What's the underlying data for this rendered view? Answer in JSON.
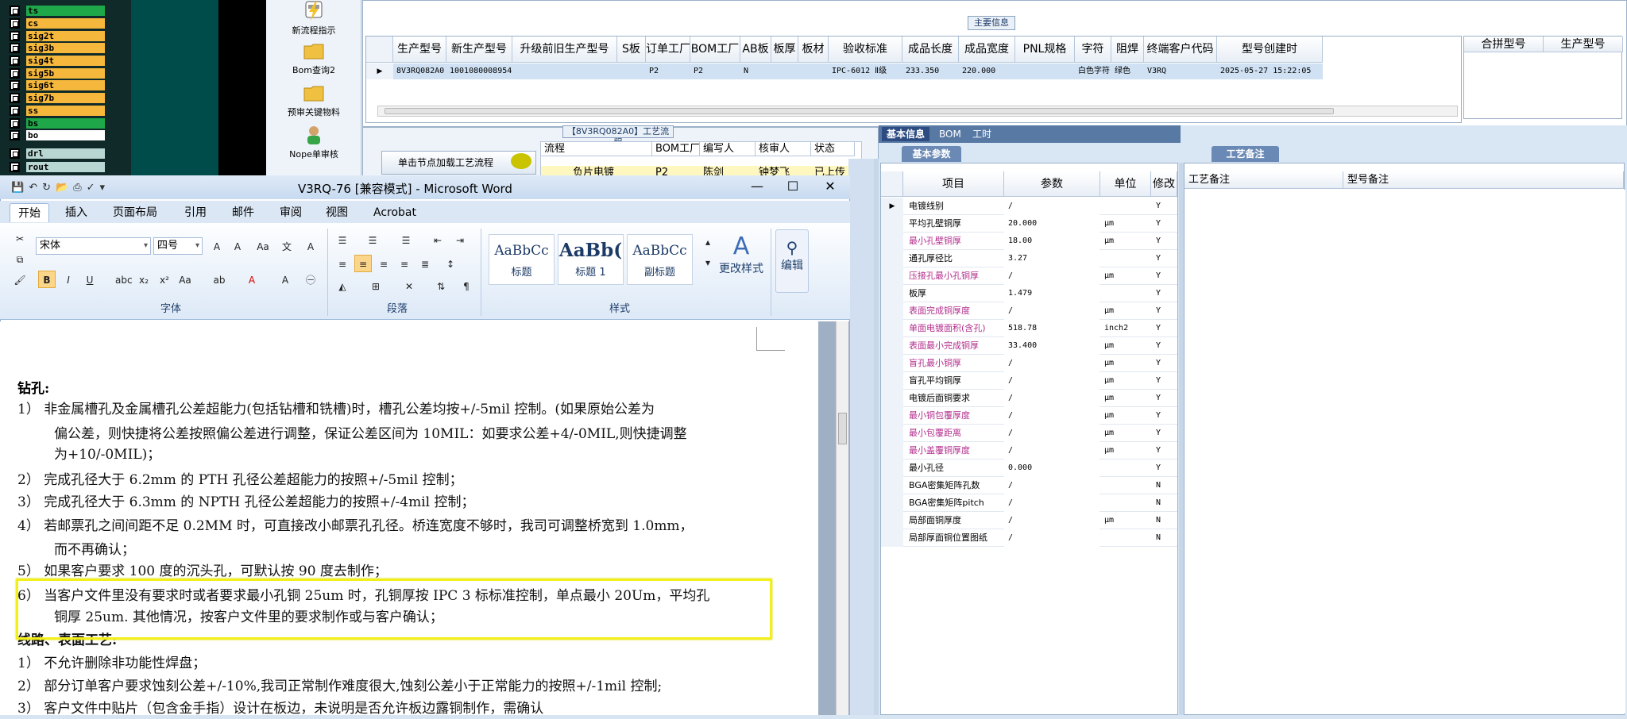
{
  "signals": [
    "ts",
    "cs",
    "sig2t",
    "sig3b",
    "sig4t",
    "sig5b",
    "sig6t",
    "sig7b",
    "ss",
    "bs",
    "bo",
    "drl",
    "rout"
  ],
  "signal_colors": [
    "#1fa84a",
    "#f6b83c",
    "#f6b83c",
    "#f6b83c",
    "#f6b83c",
    "#f6b83c",
    "#f6b83c",
    "#f6b83c",
    "#f6b83c",
    "#1fa84a",
    "#ffffff",
    "#b9d7d2",
    "#b9d7d2"
  ],
  "tools": {
    "new_flow": "新流程指示",
    "bom_query": "Bom查询2",
    "review_material": "预审关键物料",
    "nope_review": "Nope单审核"
  },
  "main": {
    "section_title": "主要信息",
    "columns": [
      "生产型号",
      "新生产型号",
      "升级前旧生产型号",
      "S板",
      "订单工厂",
      "BOM工厂",
      "AB板",
      "板厚",
      "板材",
      "验收标准",
      "成品长度",
      "成品宽度",
      "PNL规格",
      "字符",
      "阻焊",
      "终端客户代码",
      "型号创建时"
    ],
    "row": {
      "生产型号": "8V3RQ082A0",
      "新生产型号": "10010800089545",
      "订单工厂": "P2",
      "BOM工厂": "P2",
      "AB板": "N",
      "验收标准": "IPC-6012 Ⅱ级",
      "成品长度": "233.350",
      "成品宽度": "220.000",
      "字符": "白色字符",
      "阻焊": "绿色",
      "终端客户代码": "V3RQ",
      "型号创建时": "2025-05-27 15:22:05"
    },
    "side_columns": [
      "合拼型号",
      "生产型号"
    ]
  },
  "process": {
    "title": "【8V3RQ082A0】工艺流程",
    "button": "单击节点加载工艺流程",
    "columns": [
      "流程",
      "BOM工厂",
      "编写人",
      "核审人",
      "状态"
    ],
    "row": [
      "负片电镀",
      "P2",
      "陈剑",
      "钟梦飞",
      "已上传"
    ]
  },
  "right": {
    "tabs": [
      "基本信息",
      "BOM",
      "工时"
    ],
    "param_tab": "基本参数",
    "note_tab": "工艺备注",
    "param_columns": [
      "项目",
      "参数",
      "单位",
      "修改"
    ],
    "note_columns": [
      "工艺备注",
      "型号备注"
    ],
    "params": [
      {
        "name": "电镀线别",
        "value": "/",
        "unit": "",
        "mod": "Y",
        "highlight": false
      },
      {
        "name": "平均孔壁铜厚",
        "value": "20.000",
        "unit": "μm",
        "mod": "Y",
        "highlight": false
      },
      {
        "name": "最小孔壁铜厚",
        "value": "18.00",
        "unit": "μm",
        "mod": "Y",
        "highlight": true
      },
      {
        "name": "通孔厚径比",
        "value": "3.27",
        "unit": "",
        "mod": "Y",
        "highlight": false
      },
      {
        "name": "压接孔最小孔铜厚",
        "value": "/",
        "unit": "μm",
        "mod": "Y",
        "highlight": true
      },
      {
        "name": "板厚",
        "value": "1.479",
        "unit": "",
        "mod": "Y",
        "highlight": false
      },
      {
        "name": "表面完成铜厚度",
        "value": "/",
        "unit": "μm",
        "mod": "Y",
        "highlight": true
      },
      {
        "name": "单面电镀面积(含孔)",
        "value": "518.78",
        "unit": "inch2",
        "mod": "Y",
        "highlight": true
      },
      {
        "name": "表面最小完成铜厚",
        "value": "33.400",
        "unit": "μm",
        "mod": "Y",
        "highlight": true
      },
      {
        "name": "盲孔最小铜厚",
        "value": "/",
        "unit": "μm",
        "mod": "Y",
        "highlight": true
      },
      {
        "name": "盲孔平均铜厚",
        "value": "/",
        "unit": "μm",
        "mod": "Y",
        "highlight": false
      },
      {
        "name": "电镀后面铜要求",
        "value": "/",
        "unit": "μm",
        "mod": "Y",
        "highlight": false
      },
      {
        "name": "最小铜包覆厚度",
        "value": "/",
        "unit": "μm",
        "mod": "Y",
        "highlight": true
      },
      {
        "name": "最小包覆距离",
        "value": "/",
        "unit": "μm",
        "mod": "Y",
        "highlight": true
      },
      {
        "name": "最小盖覆铜厚度",
        "value": "/",
        "unit": "μm",
        "mod": "Y",
        "highlight": true
      },
      {
        "name": "最小孔径",
        "value": "0.000",
        "unit": "",
        "mod": "Y",
        "highlight": false
      },
      {
        "name": "BGA密集矩阵孔数",
        "value": "/",
        "unit": "",
        "mod": "N",
        "highlight": false
      },
      {
        "name": "BGA密集矩阵pitch",
        "value": "/",
        "unit": "",
        "mod": "N",
        "highlight": false
      },
      {
        "name": "局部面铜厚度",
        "value": "/",
        "unit": "μm",
        "mod": "N",
        "highlight": false
      },
      {
        "name": "局部厚面铜位置图纸",
        "value": "/",
        "unit": "",
        "mod": "N",
        "highlight": false
      }
    ]
  },
  "word": {
    "title": "V3RQ-76 [兼容模式] - Microsoft Word",
    "tabs": [
      "开始",
      "插入",
      "页面布局",
      "引用",
      "邮件",
      "审阅",
      "视图",
      "Acrobat"
    ],
    "font_name": "宋体",
    "font_size": "四号",
    "groups": [
      "字体",
      "段落",
      "样式"
    ],
    "styles": [
      {
        "sample": "AaBbCc",
        "name": "标题"
      },
      {
        "sample": "AaBb(",
        "name": "标题 1"
      },
      {
        "sample": "AaBbCc",
        "name": "副标题"
      }
    ],
    "change_style": "更改样式",
    "edit": "编辑",
    "doc_heading": "钻孔:",
    "lines": [
      "1） 非金属槽孔及金属槽孔公差超能力(包括钻槽和铣槽)时，槽孔公差均按+/-5mil 控制。(如果原始公差为",
      "偏公差，则快捷将公差按照偏公差进行调整，保证公差区间为 10MIL：如要求公差+4/-0MIL,则快捷调整",
      "为+10/-0MIL)；",
      "2） 完成孔径大于 6.2mm 的 PTH 孔径公差超能力的按照+/-5mil 控制；",
      "3） 完成孔径大于 6.3mm 的 NPTH 孔径公差超能力的按照+/-4mil 控制；",
      "4） 若邮票孔之间间距不足 0.2MM 时，可直接改小邮票孔孔径。桥连宽度不够时，我司可调整桥宽到 1.0mm，",
      "而不再确认；",
      "5） 如果客户要求 100 度的沉头孔，可默认按 90 度去制作；",
      "6） 当客户文件里没有要求时或者要求最小孔铜 25um 时，孔铜厚按 IPC 3 标标准控制，单点最小 20Um，平均孔",
      "铜厚 25um. 其他情况，按客户文件里的要求制作或与客户确认；",
      "线路、表面工艺:",
      "1） 不允许删除非功能性焊盘；",
      "2） 部分订单客户要求蚀刻公差+/-10%,我司正常制作难度很大,蚀刻公差小于正常能力的按照+/-1mil 控制;",
      "3） 客户文件中贴片（包含金手指）设计在板边，未说明是否允许板边露铜制作，需确认"
    ]
  }
}
